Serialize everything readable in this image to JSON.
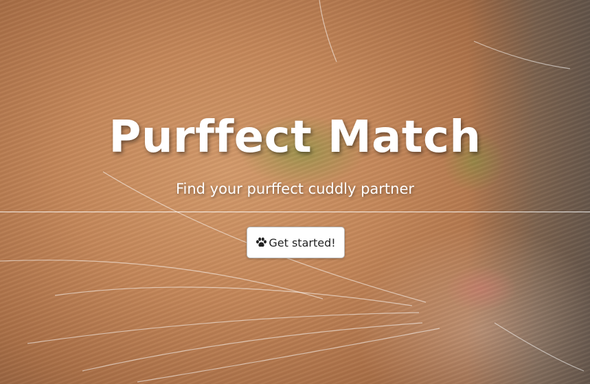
{
  "hero": {
    "title": "Purffect Match",
    "subtitle": "Find your purffect cuddly partner",
    "cta_label": "Get started!",
    "cta_icon": "paw-icon",
    "background_image": "cat-closeup"
  },
  "colors": {
    "text": "#ffffff",
    "button_bg": "#ffffff",
    "button_text": "#222222"
  }
}
